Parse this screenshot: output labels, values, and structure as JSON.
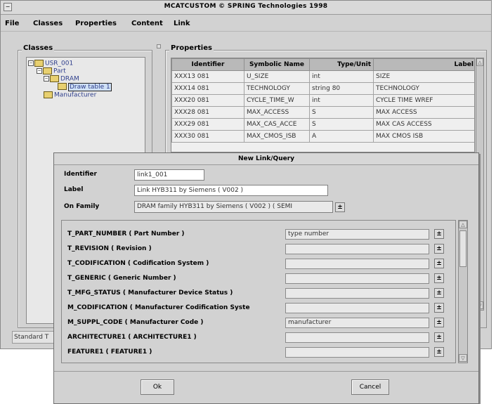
{
  "window": {
    "title": "MCATCUSTOM © SPRING Technologies 1998",
    "system_menu_glyph": "−"
  },
  "menu": [
    "File",
    "Classes",
    "Properties",
    "Content",
    "Link"
  ],
  "classes_panel": {
    "label": "Classes",
    "tree": [
      {
        "label": "USR_001",
        "depth": 0,
        "expander": "−"
      },
      {
        "label": "Part",
        "depth": 1,
        "expander": "−"
      },
      {
        "label": "DRAM",
        "depth": 2,
        "expander": "−"
      },
      {
        "label": "Draw table 1",
        "depth": 3,
        "selected": true
      },
      {
        "label": "Manufacturer",
        "depth": 1
      }
    ]
  },
  "properties_panel": {
    "label": "Properties",
    "columns": [
      "Identifier",
      "Symbolic Name",
      "Type/Unit",
      "Label"
    ],
    "rows": [
      [
        "XXX13 081",
        "U_SIZE",
        "int",
        "SIZE"
      ],
      [
        "XXX14 081",
        "TECHNOLOGY",
        "string 80",
        "TECHNOLOGY"
      ],
      [
        "XXX20 081",
        "CYCLE_TIME_W",
        "int",
        "CYCLE TIME WREF"
      ],
      [
        "XXX28 081",
        "MAX_ACCESS",
        "S",
        "MAX ACCESS"
      ],
      [
        "XXX29 081",
        "MAX_CAS_ACCE",
        "S",
        "MAX CAS ACCESS"
      ],
      [
        "XXX30 081",
        "MAX_CMOS_ISB",
        "A",
        "MAX CMOS ISB"
      ]
    ]
  },
  "status_bar": {
    "text": "Standard T"
  },
  "dialog": {
    "title": "New Link/Query",
    "identifier": {
      "label": "Identifier",
      "value": "link1_001"
    },
    "label_field": {
      "label": "Label",
      "value": "Link HYB311 by Siemens ( V002 )"
    },
    "on_family": {
      "label": "On Family",
      "value": "DRAM family HYB311 by Siemens ( V002 ) ( SEMI"
    },
    "dropdown_glyph": "±",
    "attributes": [
      {
        "label": "T_PART_NUMBER ( Part Number )",
        "value": "type number"
      },
      {
        "label": "T_REVISION ( Revision )",
        "value": ""
      },
      {
        "label": "T_CODIFICATION ( Codification System )",
        "value": ""
      },
      {
        "label": "T_GENERIC ( Generic Number )",
        "value": ""
      },
      {
        "label": "T_MFG_STATUS ( Manufacturer Device Status )",
        "value": ""
      },
      {
        "label": "M_CODIFICATION ( Manufacturer Codification Syste",
        "value": ""
      },
      {
        "label": "M_SUPPL_CODE ( Manufacturer Code )",
        "value": "manufacturer"
      },
      {
        "label": "ARCHITECTURE1 ( ARCHITECTURE1 )",
        "value": ""
      },
      {
        "label": "FEATURE1 ( FEATURE1 )",
        "value": ""
      }
    ],
    "ok_label": "Ok",
    "cancel_label": "Cancel"
  }
}
